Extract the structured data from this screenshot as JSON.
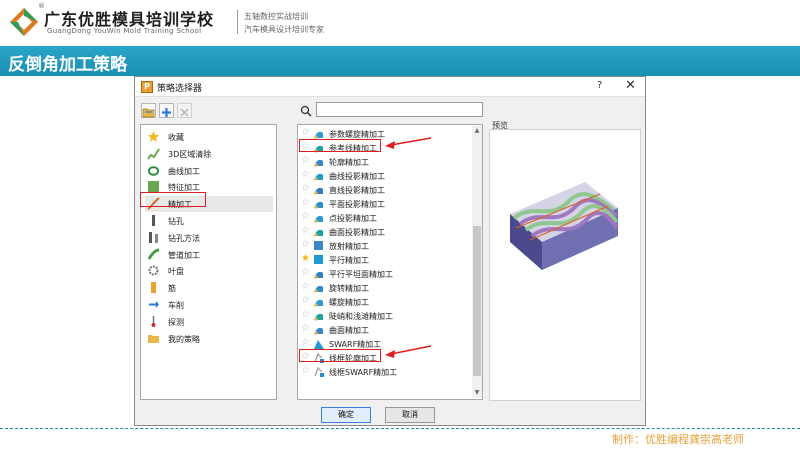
{
  "header": {
    "brand_cn": "广东优胜模具培训学校",
    "brand_en": "GuangDong YouWin Mold Training School",
    "registered_mark": "®",
    "tagline1": "五轴数控实战培训",
    "tagline2": "汽车模具设计培训专家",
    "slide_title": "反倒角加工策略",
    "accent_color": "#1a8fb4"
  },
  "dialog": {
    "title": "策略选择器",
    "help": "?",
    "close": "✕",
    "search": {
      "value": "",
      "placeholder": ""
    },
    "preview_label": "预览",
    "ok_label": "确定",
    "cancel_label": "取消"
  },
  "categories": [
    {
      "label": "收藏",
      "icon": "star-icon"
    },
    {
      "label": "3D区域清除",
      "icon": "area-clear-icon"
    },
    {
      "label": "曲线加工",
      "icon": "curve-machining-icon"
    },
    {
      "label": "特征加工",
      "icon": "feature-machining-icon"
    },
    {
      "label": "精加工",
      "icon": "finishing-icon",
      "selected": true
    },
    {
      "label": "钻孔",
      "icon": "drill-icon"
    },
    {
      "label": "钻孔方法",
      "icon": "drill-method-icon"
    },
    {
      "label": "管道加工",
      "icon": "pipe-machining-icon"
    },
    {
      "label": "叶盘",
      "icon": "blisk-icon"
    },
    {
      "label": "筋",
      "icon": "rib-icon"
    },
    {
      "label": "车削",
      "icon": "turning-icon"
    },
    {
      "label": "探测",
      "icon": "probing-icon"
    },
    {
      "label": "我的策略",
      "icon": "folder-icon"
    }
  ],
  "strategies": [
    {
      "label": "参数螺旋精加工",
      "fav": false,
      "icon": "parametric-spiral-icon"
    },
    {
      "label": "参考线精加工",
      "fav": false,
      "icon": "pattern-finishing-icon",
      "highlight": true
    },
    {
      "label": "轮廓精加工",
      "fav": false,
      "icon": "profile-finishing-icon"
    },
    {
      "label": "曲线投影精加工",
      "fav": false,
      "icon": "line-projection-icon"
    },
    {
      "label": "直线投影精加工",
      "fav": false,
      "icon": "line-projection-icon"
    },
    {
      "label": "平面投影精加工",
      "fav": false,
      "icon": "plane-projection-icon"
    },
    {
      "label": "点投影精加工",
      "fav": false,
      "icon": "point-projection-icon"
    },
    {
      "label": "曲面投影精加工",
      "fav": false,
      "icon": "surface-projection-icon"
    },
    {
      "label": "放射精加工",
      "fav": false,
      "icon": "radial-finishing-icon"
    },
    {
      "label": "平行精加工",
      "fav": true,
      "icon": "raster-finishing-icon"
    },
    {
      "label": "平行平坦面精加工",
      "fav": false,
      "icon": "flat-finishing-icon"
    },
    {
      "label": "旋转精加工",
      "fav": false,
      "icon": "rotary-finishing-icon"
    },
    {
      "label": "螺旋精加工",
      "fav": false,
      "icon": "spiral-finishing-icon"
    },
    {
      "label": "陡峭和浅滩精加工",
      "fav": false,
      "icon": "steep-shallow-icon"
    },
    {
      "label": "曲面精加工",
      "fav": false,
      "icon": "surface-finishing-icon"
    },
    {
      "label": "SWARF精加工",
      "fav": false,
      "icon": "swarf-icon"
    },
    {
      "label": "线框轮廓加工",
      "fav": false,
      "icon": "wireframe-profile-icon",
      "highlight": true
    },
    {
      "label": "线框SWARF精加工",
      "fav": false,
      "icon": "wireframe-swarf-icon"
    }
  ],
  "footer": {
    "author": "制作：优胜编程龚崇高老师"
  }
}
